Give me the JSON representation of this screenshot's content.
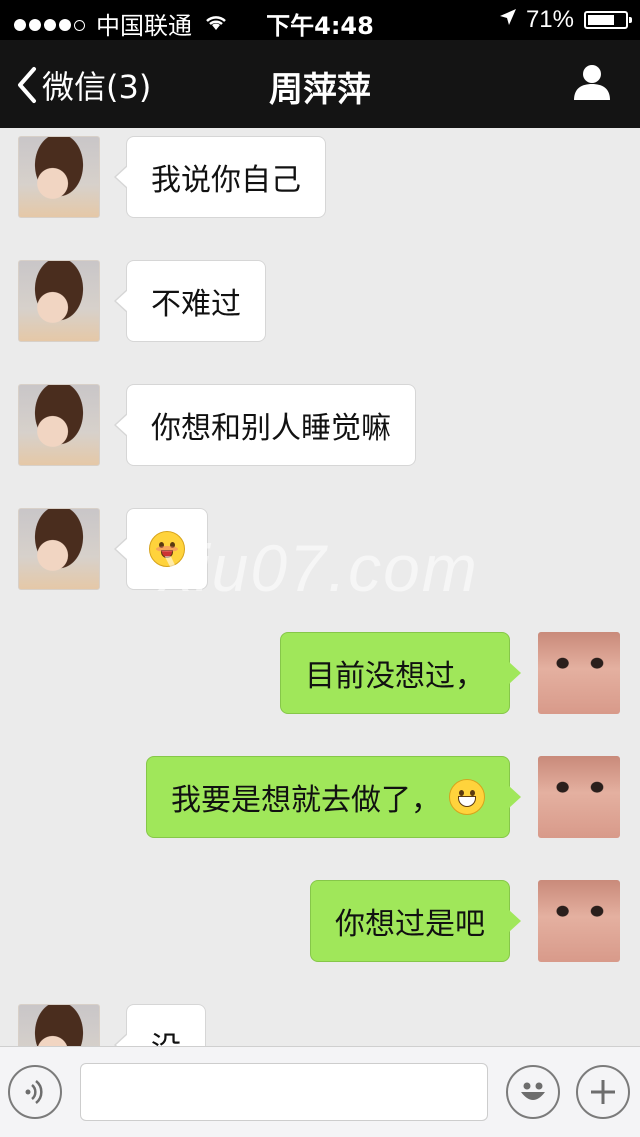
{
  "status_bar": {
    "carrier": "中国联通",
    "time": "下午4:48",
    "battery": "71%",
    "battery_level": 0.71
  },
  "nav": {
    "back_label": "微信(3)",
    "title": "周萍萍"
  },
  "messages": [
    {
      "side": "in",
      "text": "我说你自己",
      "emoji": ""
    },
    {
      "side": "in",
      "text": "不难过",
      "emoji": ""
    },
    {
      "side": "in",
      "text": "你想和别人睡觉嘛",
      "emoji": ""
    },
    {
      "side": "in",
      "text": "",
      "emoji": "tongue-face"
    },
    {
      "side": "out",
      "text": "目前没想过，",
      "emoji": ""
    },
    {
      "side": "out",
      "text": "我要是想就去做了，",
      "emoji": "grin-face"
    },
    {
      "side": "out",
      "text": "你想过是吧",
      "emoji": ""
    },
    {
      "side": "in",
      "text": "没",
      "emoji": ""
    }
  ],
  "watermark": "xiu07.com",
  "input": {
    "value": "",
    "placeholder": ""
  },
  "colors": {
    "nav_bg": "#141414",
    "chat_bg": "#ebebeb",
    "out_bubble": "#a0e75a",
    "in_bubble": "#ffffff"
  }
}
